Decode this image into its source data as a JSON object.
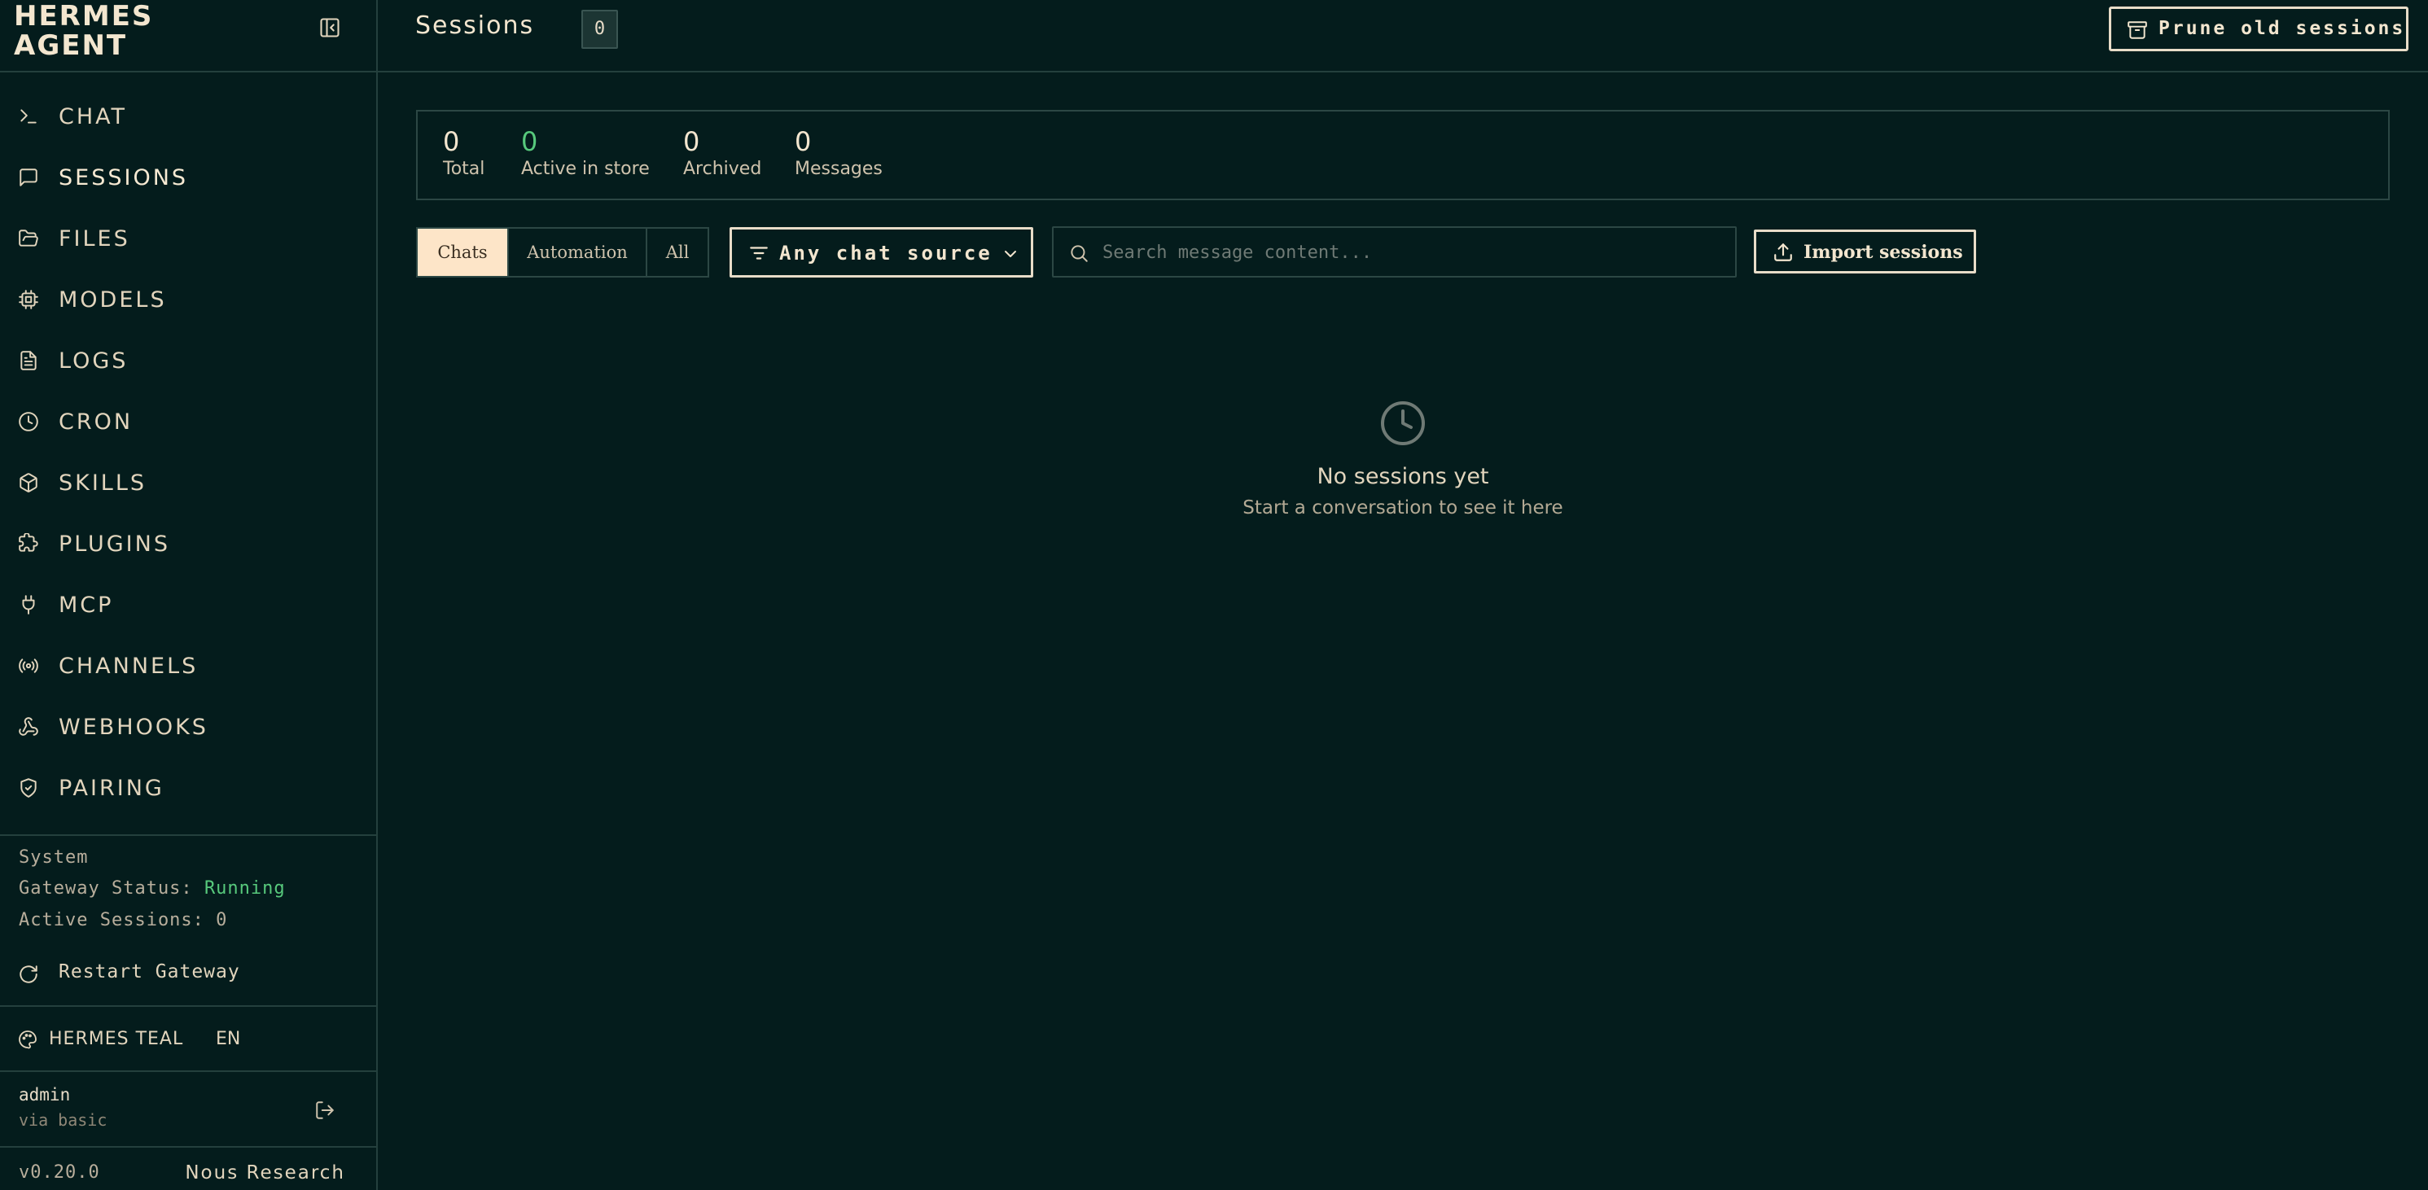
{
  "brand": {
    "title": "HERMES\nAGENT"
  },
  "nav": {
    "items": [
      {
        "label": "CHAT",
        "icon": "terminal-icon"
      },
      {
        "label": "SESSIONS",
        "icon": "message-square-icon",
        "active": true
      },
      {
        "label": "FILES",
        "icon": "folder-open-icon"
      },
      {
        "label": "MODELS",
        "icon": "cpu-icon"
      },
      {
        "label": "LOGS",
        "icon": "file-text-icon"
      },
      {
        "label": "CRON",
        "icon": "clock-icon"
      },
      {
        "label": "SKILLS",
        "icon": "package-icon"
      },
      {
        "label": "PLUGINS",
        "icon": "puzzle-icon"
      },
      {
        "label": "MCP",
        "icon": "plug-icon"
      },
      {
        "label": "CHANNELS",
        "icon": "radio-icon"
      },
      {
        "label": "WEBHOOKS",
        "icon": "webhook-icon"
      },
      {
        "label": "PAIRING",
        "icon": "shield-check-icon"
      }
    ]
  },
  "system": {
    "heading": "System",
    "gateway_label": "Gateway Status:",
    "gateway_status": "Running",
    "active_sessions": "Active Sessions: 0",
    "restart_label": "Restart Gateway"
  },
  "theme": {
    "label": "HERMES TEAL",
    "lang": "EN"
  },
  "user": {
    "name": "admin",
    "via": "via basic"
  },
  "footer": {
    "version": "v0.20.0",
    "org": "Nous Research"
  },
  "header": {
    "title": "Sessions",
    "count": "0",
    "prune_label": "Prune old sessions"
  },
  "stats": [
    {
      "value": "0",
      "caption": "Total"
    },
    {
      "value": "0",
      "caption": "Active in store"
    },
    {
      "value": "0",
      "caption": "Archived"
    },
    {
      "value": "0",
      "caption": "Messages"
    }
  ],
  "filters": {
    "tabs": [
      "Chats",
      "Automation",
      "All"
    ],
    "active_tab": "Chats",
    "source_label": "Any chat source",
    "search_placeholder": "Search message content...",
    "import_label": "Import sessions"
  },
  "empty_state": {
    "title": "No sessions yet",
    "subtitle": "Start a conversation to see it here"
  },
  "colors": {
    "background": "#041c1c",
    "text": "#e8dcc8",
    "accent_green": "#57c97c",
    "active_tab_bg": "#fde5c8",
    "border": "#24403d"
  }
}
